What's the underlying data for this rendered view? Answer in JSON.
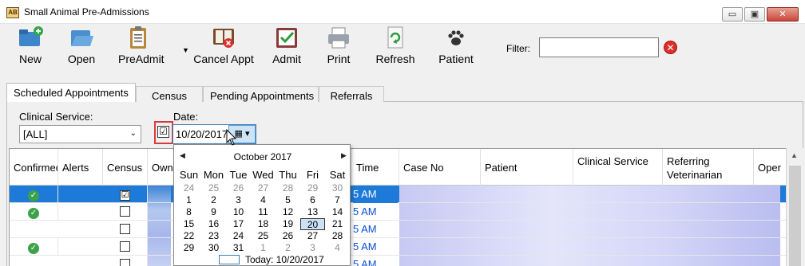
{
  "window": {
    "title": "Small Animal Pre-Admissions",
    "minimize_glyph": "▭",
    "maximize_glyph": "▣",
    "close_glyph": "✕"
  },
  "toolbar": {
    "new_label": "New",
    "open_label": "Open",
    "preadmit_label": "PreAdmit",
    "cancel_appt_label": "Cancel Appt",
    "admit_label": "Admit",
    "print_label": "Print",
    "refresh_label": "Refresh",
    "patient_label": "Patient",
    "filter_label": "Filter:",
    "filter_value": ""
  },
  "tabs": [
    {
      "label": "Scheduled Appointments"
    },
    {
      "label": "Census"
    },
    {
      "label": "Pending Appointments"
    },
    {
      "label": "Referrals"
    }
  ],
  "form": {
    "clinical_service_label": "Clinical Service:",
    "clinical_service_value": "[ALL]",
    "date_label": "Date:",
    "date_checked": "☑",
    "date_value": "10/20/2017"
  },
  "grid": {
    "headers": {
      "confirmed": "Confirmed",
      "alerts": "Alerts",
      "census": "Census",
      "owner": "Owner",
      "time": "Time",
      "case_no": "Case No",
      "patient": "Patient",
      "clinical_service": "Clinical Service",
      "referring_vet": "Referring Veterinarian",
      "oper": "Oper"
    },
    "rows": [
      {
        "confirmed": "✓",
        "census": "☑",
        "time": "AM"
      },
      {
        "confirmed": "✓",
        "census": "",
        "time": "AM"
      },
      {
        "confirmed": "",
        "census": "",
        "time": "AM"
      },
      {
        "confirmed": "✓",
        "census": "",
        "time": "AM"
      },
      {
        "confirmed": "",
        "census": "",
        "time": "AM"
      }
    ],
    "time_digits": [
      "5",
      "5",
      "5",
      "5",
      "5"
    ]
  },
  "calendar": {
    "month_title": "October 2017",
    "prev": "◀",
    "next": "▶",
    "dow": [
      "Sun",
      "Mon",
      "Tue",
      "Wed",
      "Thu",
      "Fri",
      "Sat"
    ],
    "weeks": [
      [
        "24",
        "25",
        "26",
        "27",
        "28",
        "29",
        "30"
      ],
      [
        "1",
        "2",
        "3",
        "4",
        "5",
        "6",
        "7"
      ],
      [
        "8",
        "9",
        "10",
        "11",
        "12",
        "13",
        "14"
      ],
      [
        "15",
        "16",
        "17",
        "18",
        "19",
        "20",
        "21"
      ],
      [
        "22",
        "23",
        "24",
        "25",
        "26",
        "27",
        "28"
      ],
      [
        "29",
        "30",
        "31",
        "1",
        "2",
        "3",
        "4"
      ]
    ],
    "today_text": "Today: 10/20/2017"
  },
  "colors": {
    "selection": "#1d7ad8",
    "confirmed_green": "#3aa34a",
    "highlight_red": "#d93b3b"
  }
}
